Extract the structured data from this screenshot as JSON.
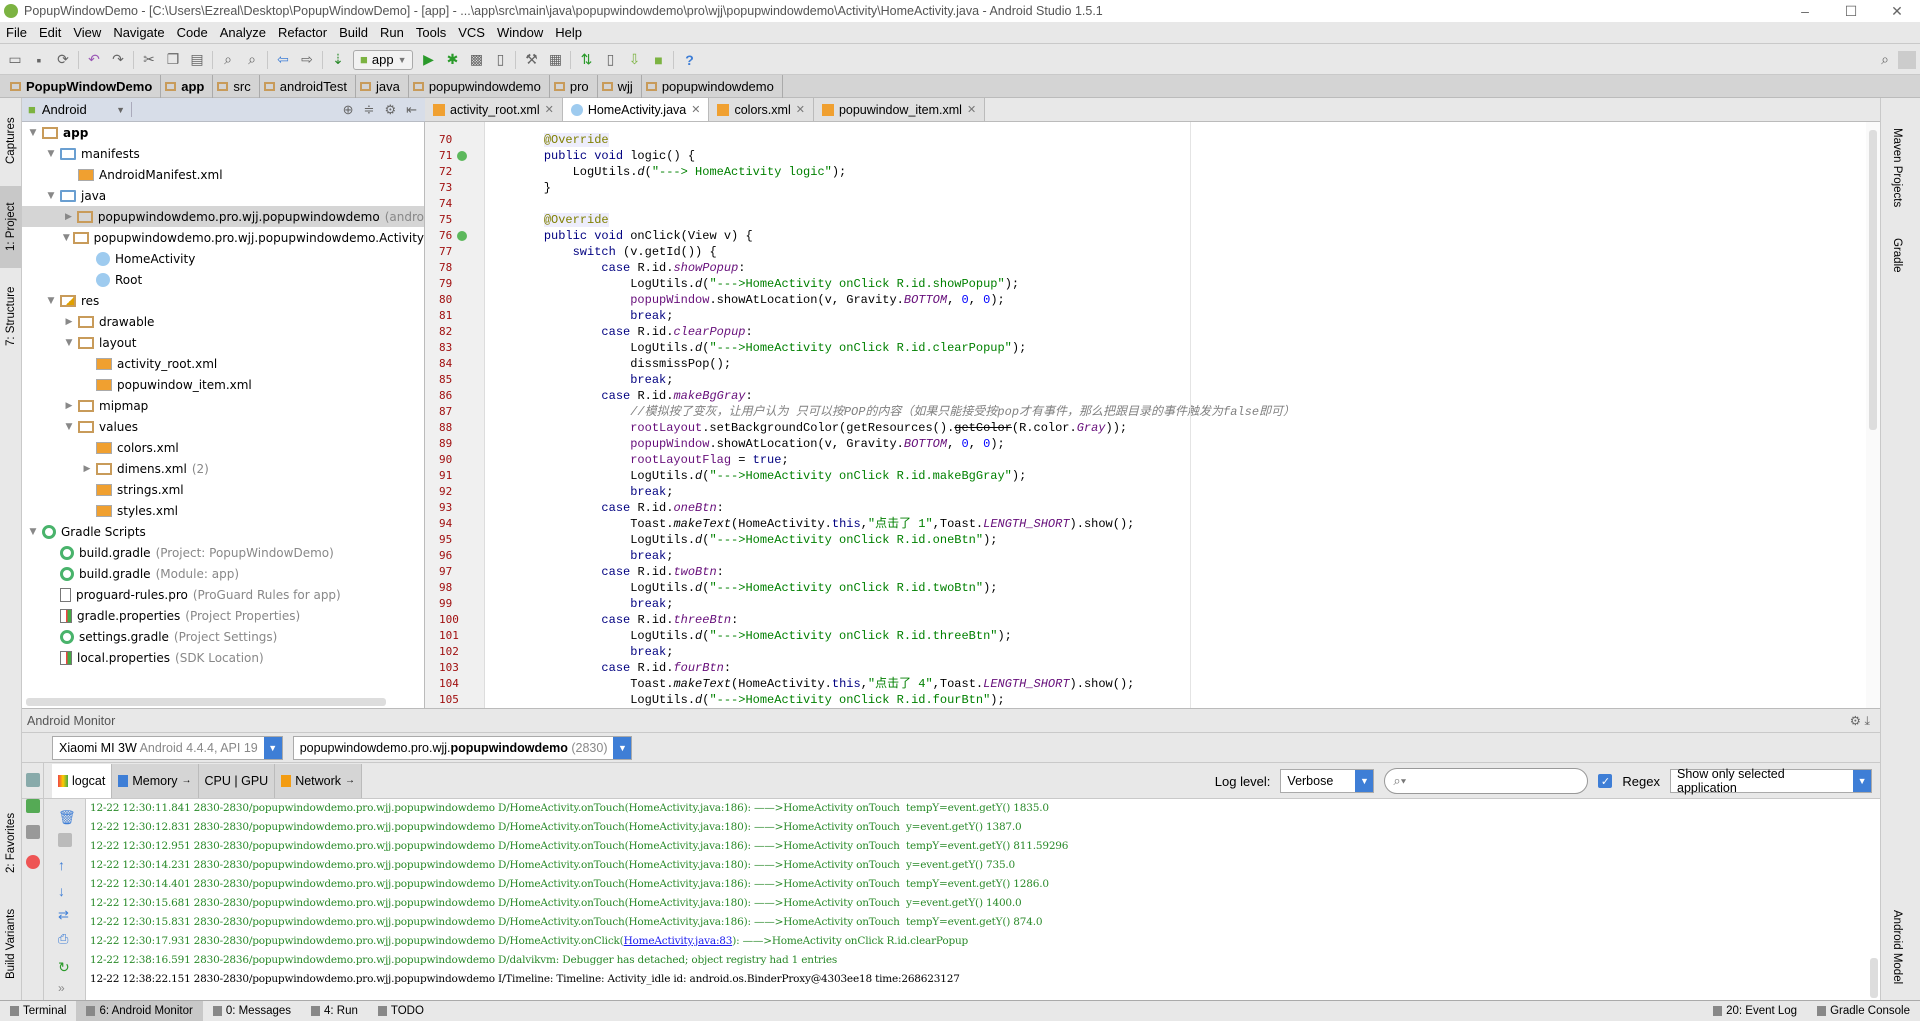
{
  "window": {
    "title": "PopupWindowDemo - [C:\\Users\\Ezreal\\Desktop\\PopupWindowDemo] - [app] - ...\\app\\src\\main\\java\\popupwindowdemo\\pro\\wjj\\popupwindowdemo\\Activity\\HomeActivity.java - Android Studio 1.5.1",
    "minimize": "–",
    "maximize": "☐",
    "close": "✕"
  },
  "menu": [
    "File",
    "Edit",
    "View",
    "Navigate",
    "Code",
    "Analyze",
    "Refactor",
    "Build",
    "Run",
    "Tools",
    "VCS",
    "Window",
    "Help"
  ],
  "toolbar": {
    "run_config": "app",
    "help": "?"
  },
  "breadcrumb": [
    "PopupWindowDemo",
    "app",
    "src",
    "androidTest",
    "java",
    "popupwindowdemo",
    "pro",
    "wjj",
    "popupwindowdemo"
  ],
  "left_strip": [
    "Captures",
    "1: Project",
    "7: Structure",
    "2: Favorites",
    "Build Variants"
  ],
  "right_strip": [
    "Maven Projects",
    "Gradle",
    "Android Model"
  ],
  "project": {
    "view_mode": "Android",
    "tree": [
      {
        "d": 0,
        "arrow": "down",
        "icon": "module",
        "label": "app",
        "bold": true
      },
      {
        "d": 1,
        "arrow": "down",
        "icon": "folder",
        "label": "manifests"
      },
      {
        "d": 2,
        "arrow": "",
        "icon": "xml",
        "label": "AndroidManifest.xml"
      },
      {
        "d": 1,
        "arrow": "down",
        "icon": "folder",
        "label": "java"
      },
      {
        "d": 2,
        "arrow": "right",
        "icon": "pkg",
        "label": "popupwindowdemo.pro.wjj.popupwindowdemo",
        "hint": "(andro",
        "selected": true
      },
      {
        "d": 2,
        "arrow": "down",
        "icon": "pkg",
        "label": "popupwindowdemo.pro.wjj.popupwindowdemo.Activity"
      },
      {
        "d": 3,
        "arrow": "",
        "icon": "cls",
        "label": "HomeActivity"
      },
      {
        "d": 3,
        "arrow": "",
        "icon": "cls",
        "label": "Root"
      },
      {
        "d": 1,
        "arrow": "down",
        "icon": "res",
        "label": "res"
      },
      {
        "d": 2,
        "arrow": "right",
        "icon": "pkg",
        "label": "drawable"
      },
      {
        "d": 2,
        "arrow": "down",
        "icon": "pkg",
        "label": "layout"
      },
      {
        "d": 3,
        "arrow": "",
        "icon": "xml",
        "label": "activity_root.xml"
      },
      {
        "d": 3,
        "arrow": "",
        "icon": "xml",
        "label": "popuwindow_item.xml"
      },
      {
        "d": 2,
        "arrow": "right",
        "icon": "pkg",
        "label": "mipmap"
      },
      {
        "d": 2,
        "arrow": "down",
        "icon": "pkg",
        "label": "values"
      },
      {
        "d": 3,
        "arrow": "",
        "icon": "xml",
        "label": "colors.xml"
      },
      {
        "d": 3,
        "arrow": "right",
        "icon": "pkg",
        "label": "dimens.xml",
        "hint": "(2)"
      },
      {
        "d": 3,
        "arrow": "",
        "icon": "xml",
        "label": "strings.xml"
      },
      {
        "d": 3,
        "arrow": "",
        "icon": "xml",
        "label": "styles.xml"
      },
      {
        "d": 0,
        "arrow": "down",
        "icon": "gradle",
        "label": "Gradle Scripts"
      },
      {
        "d": 1,
        "arrow": "",
        "icon": "gradle",
        "label": "build.gradle",
        "hint": "(Project: PopupWindowDemo)"
      },
      {
        "d": 1,
        "arrow": "",
        "icon": "gradle",
        "label": "build.gradle",
        "hint": "(Module: app)"
      },
      {
        "d": 1,
        "arrow": "",
        "icon": "file",
        "label": "proguard-rules.pro",
        "hint": "(ProGuard Rules for app)"
      },
      {
        "d": 1,
        "arrow": "",
        "icon": "props",
        "label": "gradle.properties",
        "hint": "(Project Properties)"
      },
      {
        "d": 1,
        "arrow": "",
        "icon": "gradle",
        "label": "settings.gradle",
        "hint": "(Project Settings)"
      },
      {
        "d": 1,
        "arrow": "",
        "icon": "props",
        "label": "local.properties",
        "hint": "(SDK Location)"
      }
    ]
  },
  "editor_tabs": [
    {
      "label": "activity_root.xml",
      "icon": "xml",
      "active": false
    },
    {
      "label": "HomeActivity.java",
      "icon": "class",
      "active": true
    },
    {
      "label": "colors.xml",
      "icon": "xml",
      "active": false
    },
    {
      "label": "popuwindow_item.xml",
      "icon": "xml",
      "active": false
    }
  ],
  "code": {
    "first_line": 70,
    "markers": {
      "71": "implements",
      "76": "implements"
    },
    "lines": [
      [
        [
          "    ",
          ""
        ],
        [
          "@Override",
          "ann"
        ]
      ],
      [
        [
          "    ",
          ""
        ],
        [
          "public void ",
          "kw"
        ],
        [
          "logic() {",
          ""
        ]
      ],
      [
        [
          "        LogUtils.",
          ""
        ],
        [
          "d",
          "mth"
        ],
        [
          "(",
          ""
        ],
        [
          "\"---> HomeActivity logic\"",
          "str"
        ],
        [
          ");",
          ""
        ]
      ],
      [
        [
          "    }",
          ""
        ]
      ],
      [],
      [
        [
          "    ",
          ""
        ],
        [
          "@Override",
          "ann"
        ]
      ],
      [
        [
          "    ",
          ""
        ],
        [
          "public void ",
          "kw"
        ],
        [
          "onClick(View v) {",
          ""
        ]
      ],
      [
        [
          "        ",
          ""
        ],
        [
          "switch ",
          "kw"
        ],
        [
          "(v.getId()) {",
          ""
        ]
      ],
      [
        [
          "            ",
          ""
        ],
        [
          "case ",
          "kw"
        ],
        [
          "R.id.",
          ""
        ],
        [
          "showPopup",
          "sfld"
        ],
        [
          ":",
          ""
        ]
      ],
      [
        [
          "                LogUtils.",
          ""
        ],
        [
          "d",
          "mth"
        ],
        [
          "(",
          ""
        ],
        [
          "\"--->HomeActivity onClick R.id.showPopup\"",
          "str"
        ],
        [
          ");",
          ""
        ]
      ],
      [
        [
          "                ",
          ""
        ],
        [
          "popupWindow",
          "fld"
        ],
        [
          ".showAtLocation(v, Gravity.",
          ""
        ],
        [
          "BOTTOM",
          "sfld"
        ],
        [
          ", ",
          ""
        ],
        [
          "0",
          "num"
        ],
        [
          ", ",
          ""
        ],
        [
          "0",
          "num"
        ],
        [
          ");",
          ""
        ]
      ],
      [
        [
          "                ",
          ""
        ],
        [
          "break",
          "kw"
        ],
        [
          ";",
          ""
        ]
      ],
      [
        [
          "            ",
          ""
        ],
        [
          "case ",
          "kw"
        ],
        [
          "R.id.",
          ""
        ],
        [
          "clearPopup",
          "sfld"
        ],
        [
          ":",
          ""
        ]
      ],
      [
        [
          "                LogUtils.",
          ""
        ],
        [
          "d",
          "mth"
        ],
        [
          "(",
          ""
        ],
        [
          "\"--->HomeActivity onClick R.id.clearPopup\"",
          "str"
        ],
        [
          ");",
          ""
        ]
      ],
      [
        [
          "                dissmissPop();",
          ""
        ]
      ],
      [
        [
          "                ",
          ""
        ],
        [
          "break",
          "kw"
        ],
        [
          ";",
          ""
        ]
      ],
      [
        [
          "            ",
          ""
        ],
        [
          "case ",
          "kw"
        ],
        [
          "R.id.",
          ""
        ],
        [
          "makeBgGray",
          "sfld"
        ],
        [
          ":",
          ""
        ]
      ],
      [
        [
          "                ",
          ""
        ],
        [
          "//模拟按了变灰，让用户认为 只可以按POP的内容（如果只能接受按pop才有事件，那么把跟目录的事件触发为false即可）",
          "cmt"
        ]
      ],
      [
        [
          "                ",
          ""
        ],
        [
          "rootLayout",
          "fld"
        ],
        [
          ".setBackgroundColor(getResources().",
          ""
        ],
        [
          "getColor",
          "dep"
        ],
        [
          "(R.color.",
          ""
        ],
        [
          "Gray",
          "sfld"
        ],
        [
          "));",
          ""
        ]
      ],
      [
        [
          "                ",
          ""
        ],
        [
          "popupWindow",
          "fld"
        ],
        [
          ".showAtLocation(v, Gravity.",
          ""
        ],
        [
          "BOTTOM",
          "sfld"
        ],
        [
          ", ",
          ""
        ],
        [
          "0",
          "num"
        ],
        [
          ", ",
          ""
        ],
        [
          "0",
          "num"
        ],
        [
          ");",
          ""
        ]
      ],
      [
        [
          "                ",
          ""
        ],
        [
          "rootLayoutFlag",
          "fld"
        ],
        [
          " = ",
          ""
        ],
        [
          "true",
          "kw"
        ],
        [
          ";",
          ""
        ]
      ],
      [
        [
          "                LogUtils.",
          ""
        ],
        [
          "d",
          "mth"
        ],
        [
          "(",
          ""
        ],
        [
          "\"--->HomeActivity onClick R.id.makeBgGray\"",
          "str"
        ],
        [
          ");",
          ""
        ]
      ],
      [
        [
          "                ",
          ""
        ],
        [
          "break",
          "kw"
        ],
        [
          ";",
          ""
        ]
      ],
      [
        [
          "            ",
          ""
        ],
        [
          "case ",
          "kw"
        ],
        [
          "R.id.",
          ""
        ],
        [
          "oneBtn",
          "sfld"
        ],
        [
          ":",
          ""
        ]
      ],
      [
        [
          "                Toast.",
          ""
        ],
        [
          "makeText",
          "mth"
        ],
        [
          "(HomeActivity.",
          ""
        ],
        [
          "this",
          "kw"
        ],
        [
          ",",
          ""
        ],
        [
          "\"点击了 1\"",
          "str"
        ],
        [
          ",Toast.",
          ""
        ],
        [
          "LENGTH_SHORT",
          "sfld"
        ],
        [
          ").show();",
          ""
        ]
      ],
      [
        [
          "                LogUtils.",
          ""
        ],
        [
          "d",
          "mth"
        ],
        [
          "(",
          ""
        ],
        [
          "\"--->HomeActivity onClick R.id.oneBtn\"",
          "str"
        ],
        [
          ");",
          ""
        ]
      ],
      [
        [
          "                ",
          ""
        ],
        [
          "break",
          "kw"
        ],
        [
          ";",
          ""
        ]
      ],
      [
        [
          "            ",
          ""
        ],
        [
          "case ",
          "kw"
        ],
        [
          "R.id.",
          ""
        ],
        [
          "twoBtn",
          "sfld"
        ],
        [
          ":",
          ""
        ]
      ],
      [
        [
          "                LogUtils.",
          ""
        ],
        [
          "d",
          "mth"
        ],
        [
          "(",
          ""
        ],
        [
          "\"--->HomeActivity onClick R.id.twoBtn\"",
          "str"
        ],
        [
          ");",
          ""
        ]
      ],
      [
        [
          "                ",
          ""
        ],
        [
          "break",
          "kw"
        ],
        [
          ";",
          ""
        ]
      ],
      [
        [
          "            ",
          ""
        ],
        [
          "case ",
          "kw"
        ],
        [
          "R.id.",
          ""
        ],
        [
          "threeBtn",
          "sfld"
        ],
        [
          ":",
          ""
        ]
      ],
      [
        [
          "                LogUtils.",
          ""
        ],
        [
          "d",
          "mth"
        ],
        [
          "(",
          ""
        ],
        [
          "\"--->HomeActivity onClick R.id.threeBtn\"",
          "str"
        ],
        [
          ");",
          ""
        ]
      ],
      [
        [
          "                ",
          ""
        ],
        [
          "break",
          "kw"
        ],
        [
          ";",
          ""
        ]
      ],
      [
        [
          "            ",
          ""
        ],
        [
          "case ",
          "kw"
        ],
        [
          "R.id.",
          ""
        ],
        [
          "fourBtn",
          "sfld"
        ],
        [
          ":",
          ""
        ]
      ],
      [
        [
          "                Toast.",
          ""
        ],
        [
          "makeText",
          "mth"
        ],
        [
          "(HomeActivity.",
          ""
        ],
        [
          "this",
          "kw"
        ],
        [
          ",",
          ""
        ],
        [
          "\"点击了 4\"",
          "str"
        ],
        [
          ",Toast.",
          ""
        ],
        [
          "LENGTH_SHORT",
          "sfld"
        ],
        [
          ").show();",
          ""
        ]
      ],
      [
        [
          "                LogUtils.",
          ""
        ],
        [
          "d",
          "mth"
        ],
        [
          "(",
          ""
        ],
        [
          "\"--->HomeActivity onClick R.id.fourBtn\"",
          "str"
        ],
        [
          ");",
          ""
        ]
      ]
    ]
  },
  "monitor": {
    "title": "Android Monitor",
    "device": "Xiaomi MI 3W",
    "device_info": "Android 4.4.4, API 19",
    "process_prefix": "popupwindowdemo.pro.wjj.",
    "process_name": "popupwindowdemo",
    "process_pid": "(2830)",
    "tabs": [
      "logcat",
      "Memory",
      "CPU | GPU",
      "Network"
    ],
    "log_level_label": "Log level:",
    "log_level": "Verbose",
    "search_value": "",
    "regex_label": "Regex",
    "regex_checked": true,
    "filter": "Show only selected application",
    "log": [
      {
        "t": "12-22 12:30:11.841 2830-2830/popupwindowdemo.pro.wjj.popupwindowdemo D/HomeActivity.onTouch(HomeActivity.java:186): ——>HomeActivity onTouch  tempY=event.getY() 1835.0"
      },
      {
        "t": "12-22 12:30:12.831 2830-2830/popupwindowdemo.pro.wjj.popupwindowdemo D/HomeActivity.onTouch(HomeActivity.java:180): ——>HomeActivity onTouch  y=event.getY() 1387.0"
      },
      {
        "t": "12-22 12:30:12.951 2830-2830/popupwindowdemo.pro.wjj.popupwindowdemo D/HomeActivity.onTouch(HomeActivity.java:186): ——>HomeActivity onTouch  tempY=event.getY() 811.59296"
      },
      {
        "t": "12-22 12:30:14.231 2830-2830/popupwindowdemo.pro.wjj.popupwindowdemo D/HomeActivity.onTouch(HomeActivity.java:180): ——>HomeActivity onTouch  y=event.getY() 735.0"
      },
      {
        "t": "12-22 12:30:14.401 2830-2830/popupwindowdemo.pro.wjj.popupwindowdemo D/HomeActivity.onTouch(HomeActivity.java:186): ——>HomeActivity onTouch  tempY=event.getY() 1286.0"
      },
      {
        "t": "12-22 12:30:15.681 2830-2830/popupwindowdemo.pro.wjj.popupwindowdemo D/HomeActivity.onTouch(HomeActivity.java:180): ——>HomeActivity onTouch  y=event.getY() 1400.0"
      },
      {
        "t": "12-22 12:30:15.831 2830-2830/popupwindowdemo.pro.wjj.popupwindowdemo D/HomeActivity.onTouch(HomeActivity.java:186): ——>HomeActivity onTouch  tempY=event.getY() 874.0"
      },
      {
        "t": "12-22 12:30:17.931 2830-2830/popupwindowdemo.pro.wjj.popupwindowdemo D/HomeActivity.onClick(",
        "link": "HomeActivity.java:83",
        "after": "): ——>HomeActivity onClick R.id.clearPopup"
      },
      {
        "t": "12-22 12:38:16.591 2830-2836/popupwindowdemo.pro.wjj.popupwindowdemo D/dalvikvm: Debugger has detached; object registry had 1 entries"
      },
      {
        "t": "12-22 12:38:22.151 2830-2830/popupwindowdemo.pro.wjj.popupwindowdemo I/Timeline: Timeline: Activity_idle id: android.os.BinderProxy@4303ee18 time:268623127",
        "level": "info"
      }
    ]
  },
  "statusbar": {
    "left": [
      "Terminal",
      "6: Android Monitor",
      "0: Messages",
      "4: Run",
      "TODO"
    ],
    "right": [
      "20: Event Log",
      "Gradle Console"
    ]
  },
  "colors": {
    "accent": "#3e7ed6",
    "keyword": "#000080",
    "string": "#008000",
    "field": "#660e7a",
    "log_debug": "#2a8a2a"
  }
}
